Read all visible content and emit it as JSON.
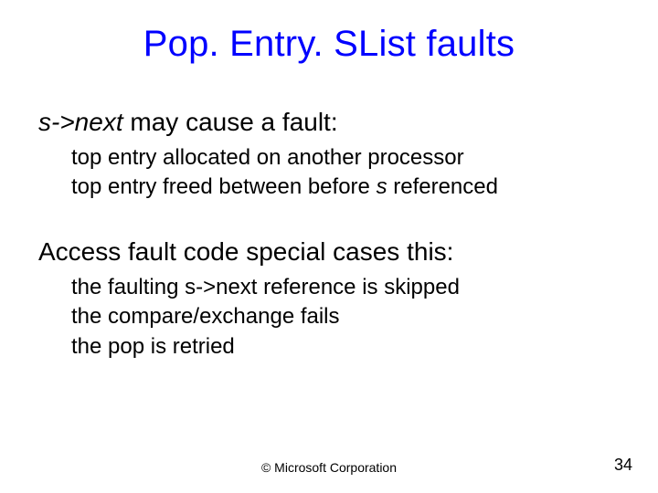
{
  "title": "Pop. Entry. SList faults",
  "groups": [
    {
      "lead_parts": [
        {
          "text": "s->next",
          "italic": true
        },
        {
          "text": " may cause a fault:",
          "italic": false
        }
      ],
      "subs": [
        [
          {
            "text": "top entry allocated on another processor",
            "italic": false
          }
        ],
        [
          {
            "text": "top entry freed between before ",
            "italic": false
          },
          {
            "text": "s",
            "italic": true
          },
          {
            "text": " referenced",
            "italic": false
          }
        ]
      ]
    },
    {
      "lead_parts": [
        {
          "text": "Access fault code special cases this:",
          "italic": false
        }
      ],
      "subs": [
        [
          {
            "text": "the faulting s->next reference is skipped",
            "italic": false
          }
        ],
        [
          {
            "text": "the compare/exchange fails",
            "italic": false
          }
        ],
        [
          {
            "text": "the pop is retried",
            "italic": false
          }
        ]
      ]
    }
  ],
  "footer": "© Microsoft Corporation",
  "page_number": "34"
}
